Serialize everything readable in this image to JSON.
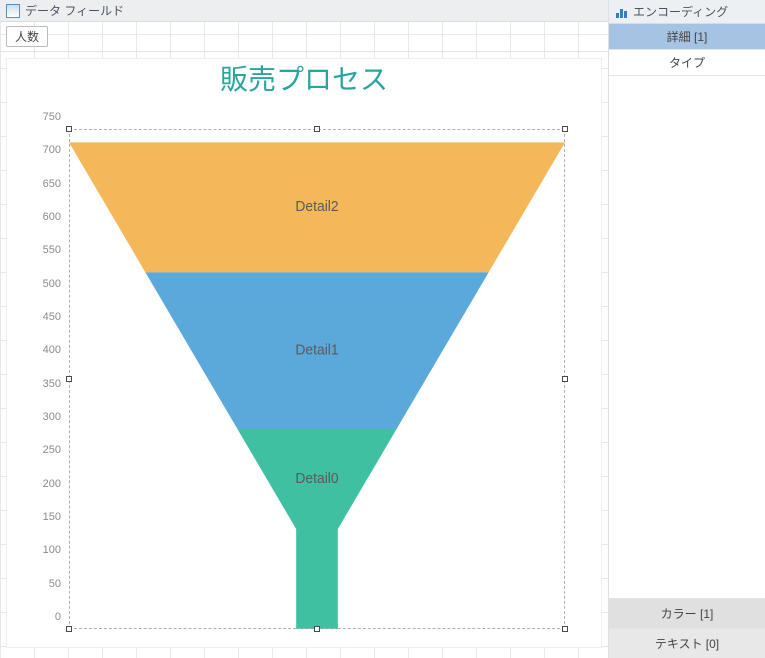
{
  "top_bar": {
    "title": "データ フィールド",
    "field_tag": "人数"
  },
  "side": {
    "title": "エンコーディング",
    "detail": "詳細 [1]",
    "type": "タイプ",
    "color": "カラー [1]",
    "text": "テキスト [0]"
  },
  "chart": {
    "title": "販売プロセス"
  },
  "chart_data": {
    "type": "funnel",
    "title": "販売プロセス",
    "ylabel": "",
    "ylim": [
      0,
      750
    ],
    "ticks": [
      0,
      50,
      100,
      150,
      200,
      250,
      300,
      350,
      400,
      450,
      500,
      550,
      600,
      650,
      700,
      750
    ],
    "segments": [
      {
        "name": "Detail2",
        "value": 195,
        "cumulative_top": 730,
        "color": "#f4b85b"
      },
      {
        "name": "Detail1",
        "value": 235,
        "cumulative_top": 535,
        "color": "#5ba9db"
      },
      {
        "name": "Detail0",
        "value": 300,
        "cumulative_top": 300,
        "color": "#3fc1a1"
      }
    ]
  }
}
